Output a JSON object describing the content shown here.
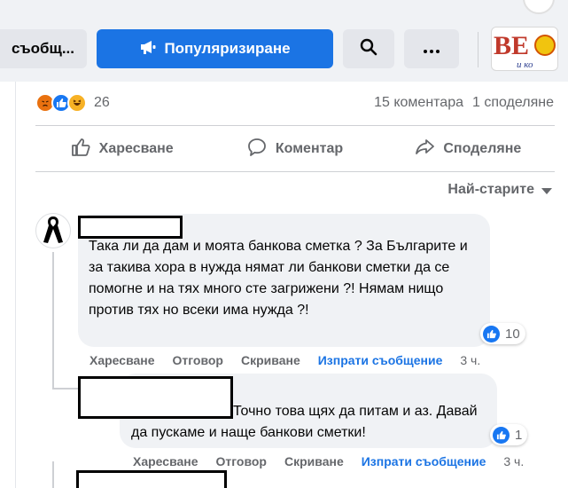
{
  "toolbar": {
    "message_label": "съобщ...",
    "promote_label": "Популяризиране",
    "logo_text": "BE",
    "logo_subtext": "и ко"
  },
  "post": {
    "reaction_count": "26",
    "comments_count": "15 коментара",
    "shares_count": "1 споделяне",
    "actions": {
      "like": "Харесване",
      "comment": "Коментар",
      "share": "Споделяне"
    },
    "sort_label": "Най-старите"
  },
  "comments": [
    {
      "text": "Така ли да дам и моята банкова сметка ? За Българите и за такива хора в нужда нямат ли банкови сметки да се помогне и на тях много сте загрижени ?! Нямам нищо против тях но всеки има нужда ?!",
      "likes": "10",
      "actions": {
        "like": "Харесване",
        "reply": "Отговор",
        "hide": "Скриване",
        "message": "Изпрати съобщение",
        "time": "3 ч."
      }
    },
    {
      "text": "Точно това щях да питам и аз. Давай да пускаме и наще банкови сметки!",
      "likes": "1",
      "actions": {
        "like": "Харесване",
        "reply": "Отговор",
        "hide": "Скриване",
        "message": "Изпрати съобщение",
        "time": "3 ч."
      }
    }
  ],
  "colors": {
    "primary": "#1b74e4",
    "secondary_text": "#65676b",
    "bubble": "#f0f2f5",
    "toolbar_bg": "#f0f2f5"
  },
  "icons": [
    "megaphone-icon",
    "search-icon",
    "more-icon",
    "like-icon",
    "comment-icon",
    "share-icon",
    "mourning-ribbon-icon",
    "caret-down-icon"
  ]
}
